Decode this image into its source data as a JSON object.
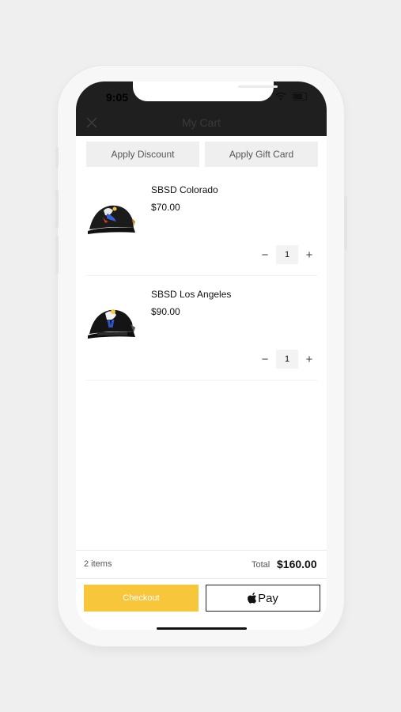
{
  "status_bar": {
    "time": "9:05"
  },
  "header": {
    "title": "My Cart",
    "close_icon": "close-icon"
  },
  "actions": {
    "discount_label": "Apply Discount",
    "gift_card_label": "Apply Gift Card"
  },
  "cart_items": [
    {
      "name": "SBSD Colorado",
      "price": "$70.00",
      "quantity": "1"
    },
    {
      "name": "SBSD Los Angeles",
      "price": "$90.00",
      "quantity": "1"
    }
  ],
  "summary": {
    "item_count": "2 items",
    "total_label": "Total",
    "total_value": "$160.00"
  },
  "footer": {
    "checkout_label": "Checkout",
    "apple_pay_label": "Pay"
  },
  "colors": {
    "topbar": "#1f1f1f",
    "checkout": "#f8c63a"
  }
}
